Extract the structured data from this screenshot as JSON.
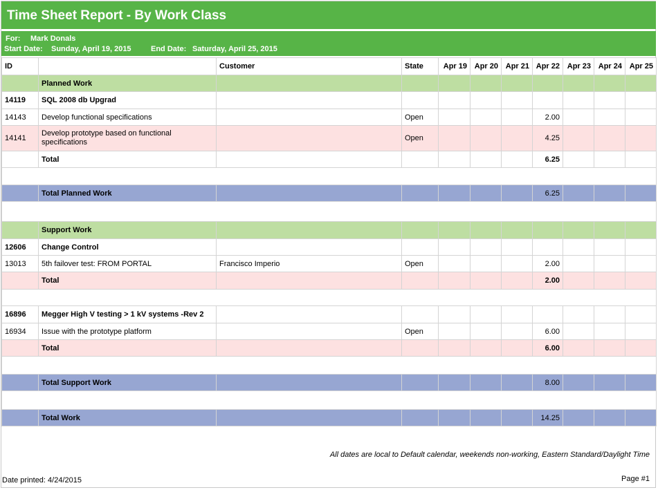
{
  "report": {
    "title": "Time Sheet Report - By Work Class",
    "for_label": "For:",
    "for_value": "Mark Donals",
    "start_label": "Start Date:",
    "start_value": "Sunday, April 19, 2015",
    "end_label": "End Date:",
    "end_value": "Saturday, April 25, 2015"
  },
  "columns": {
    "id": "ID",
    "name": "",
    "customer": "Customer",
    "state": "State",
    "days": [
      "Apr 19",
      "Apr 20",
      "Apr 21",
      "Apr 22",
      "Apr 23",
      "Apr 24",
      "Apr 25"
    ]
  },
  "planned": {
    "header": "Planned Work",
    "group1": {
      "id": "14119",
      "name": "SQL 2008 db Upgrad",
      "row1": {
        "id": "14143",
        "name": "Develop functional specifications",
        "customer": "",
        "state": "Open",
        "apr22": "2.00"
      },
      "row2": {
        "id": "14141",
        "name": "Develop prototype based on functional specifications",
        "customer": "",
        "state": "Open",
        "apr22": "4.25"
      },
      "total_label": "Total",
      "total_apr22": "6.25"
    },
    "total_label": "Total Planned Work",
    "total_apr22": "6.25"
  },
  "support": {
    "header": "Support Work",
    "group1": {
      "id": "12606",
      "name": "Change Control",
      "row1": {
        "id": "13013",
        "name": "5th failover test: FROM PORTAL",
        "customer": "Francisco Imperio",
        "state": "Open",
        "apr22": "2.00"
      },
      "total_label": "Total",
      "total_apr22": "2.00"
    },
    "group2": {
      "id": "16896",
      "name": "Megger High V testing > 1 kV systems -Rev 2",
      "row1": {
        "id": "16934",
        "name": "Issue with the prototype platform",
        "customer": "",
        "state": "Open",
        "apr22": "6.00"
      },
      "total_label": "Total",
      "total_apr22": "6.00"
    },
    "total_label": "Total Support Work",
    "total_apr22": "8.00"
  },
  "grand_total": {
    "label": "Total Work",
    "apr22": "14.25"
  },
  "footer": {
    "note": "All dates are local to Default calendar, weekends non-working, Eastern Standard/Daylight Time",
    "printed": "Date printed: 4/24/2015",
    "page": "Page #1"
  },
  "colors": {
    "header_green": "#57b447",
    "section_green": "#bedea2",
    "total_blue": "#97a6d2",
    "row_pink": "#fde1e1"
  }
}
